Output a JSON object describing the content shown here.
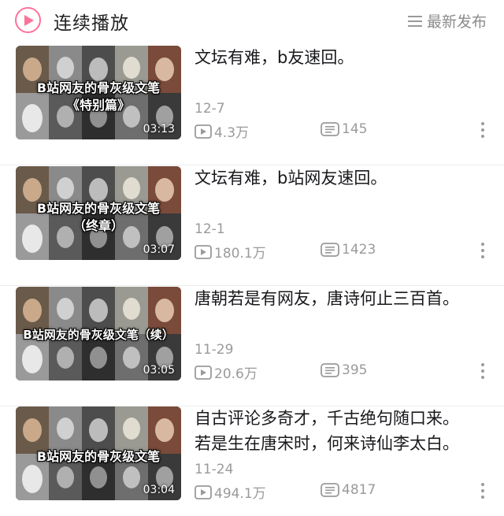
{
  "header": {
    "title": "连续播放",
    "sort_label": "最新发布",
    "colors": {
      "accent": "#fb7299"
    }
  },
  "videos": [
    {
      "thumb_line1": "B站网友的骨灰级文笔",
      "thumb_line2": "《特别篇》",
      "duration": "03:13",
      "title_line1": "文坛有难，b友速回。",
      "title_line2": "",
      "date": "12-7",
      "views": "4.3万",
      "danmaku": "145"
    },
    {
      "thumb_line1": "B站网友的骨灰级文笔",
      "thumb_line2": "（终章）",
      "duration": "03:07",
      "title_line1": "文坛有难，b站网友速回。",
      "title_line2": "",
      "date": "12-1",
      "views": "180.1万",
      "danmaku": "1423"
    },
    {
      "thumb_line1": "B站网友的骨灰级文笔（续）",
      "thumb_line2": "",
      "duration": "03:05",
      "title_line1": "唐朝若是有网友，唐诗何止三百首。",
      "title_line2": "",
      "date": "11-29",
      "views": "20.6万",
      "danmaku": "395"
    },
    {
      "thumb_line1": "B站网友的骨灰级文笔",
      "thumb_line2": "",
      "duration": "03:04",
      "title_line1": "自古评论多奇才，千古绝句随口来。",
      "title_line2": "若是生在唐宋时，何来诗仙李太白。",
      "date": "11-24",
      "views": "494.1万",
      "danmaku": "4817"
    }
  ]
}
